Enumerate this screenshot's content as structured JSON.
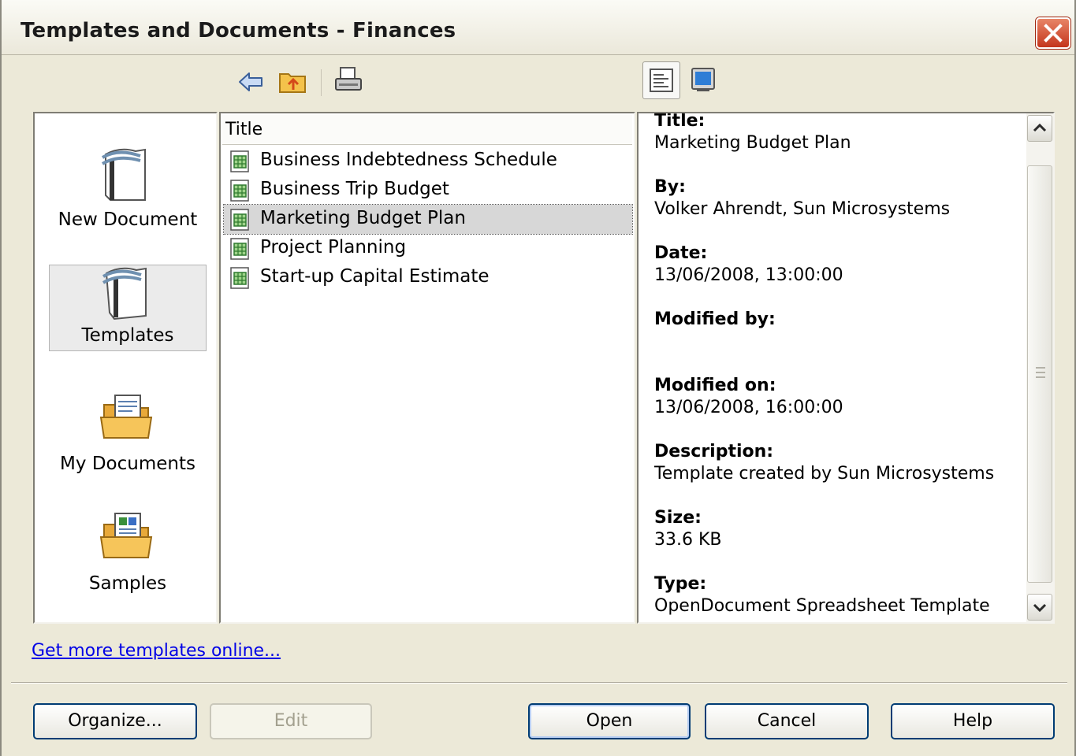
{
  "window": {
    "title": "Templates and Documents - Finances",
    "close_icon": "close-x-icon"
  },
  "toolbar": {
    "back_icon": "back-arrow-icon",
    "up_folder_icon": "folder-up-icon",
    "print_icon": "printer-icon",
    "document_properties_icon": "document-properties-icon",
    "preview_icon": "preview-monitor-icon"
  },
  "categories": [
    {
      "label": "New Document",
      "icon": "new-document-icon",
      "selected": false
    },
    {
      "label": "Templates",
      "icon": "templates-icon",
      "selected": true
    },
    {
      "label": "My Documents",
      "icon": "my-documents-folder-icon",
      "selected": false
    },
    {
      "label": "Samples",
      "icon": "samples-folder-icon",
      "selected": false
    }
  ],
  "file_list": {
    "column_header": "Title",
    "items": [
      {
        "name": "Business Indebtedness Schedule",
        "selected": false
      },
      {
        "name": "Business Trip Budget",
        "selected": false
      },
      {
        "name": "Marketing Budget Plan",
        "selected": true
      },
      {
        "name": "Project Planning",
        "selected": false
      },
      {
        "name": "Start-up Capital Estimate",
        "selected": false
      }
    ]
  },
  "properties": [
    {
      "label": "Title:",
      "value": "Marketing Budget Plan"
    },
    {
      "label": "By:",
      "value": "Volker Ahrendt, Sun Microsystems"
    },
    {
      "label": "Date:",
      "value": "13/06/2008, 13:00:00"
    },
    {
      "label": "Modified by:",
      "value": ""
    },
    {
      "label": "Modified on:",
      "value": "13/06/2008, 16:00:00"
    },
    {
      "label": "Description:",
      "value": "Template created by Sun Microsystems"
    },
    {
      "label": "Size:",
      "value": "33.6 KB"
    },
    {
      "label": "Type:",
      "value": "OpenDocument Spreadsheet Template"
    }
  ],
  "link": {
    "label": "Get more templates online..."
  },
  "buttons": {
    "organize": "Organize...",
    "edit": "Edit",
    "open": "Open",
    "cancel": "Cancel",
    "help": "Help"
  }
}
